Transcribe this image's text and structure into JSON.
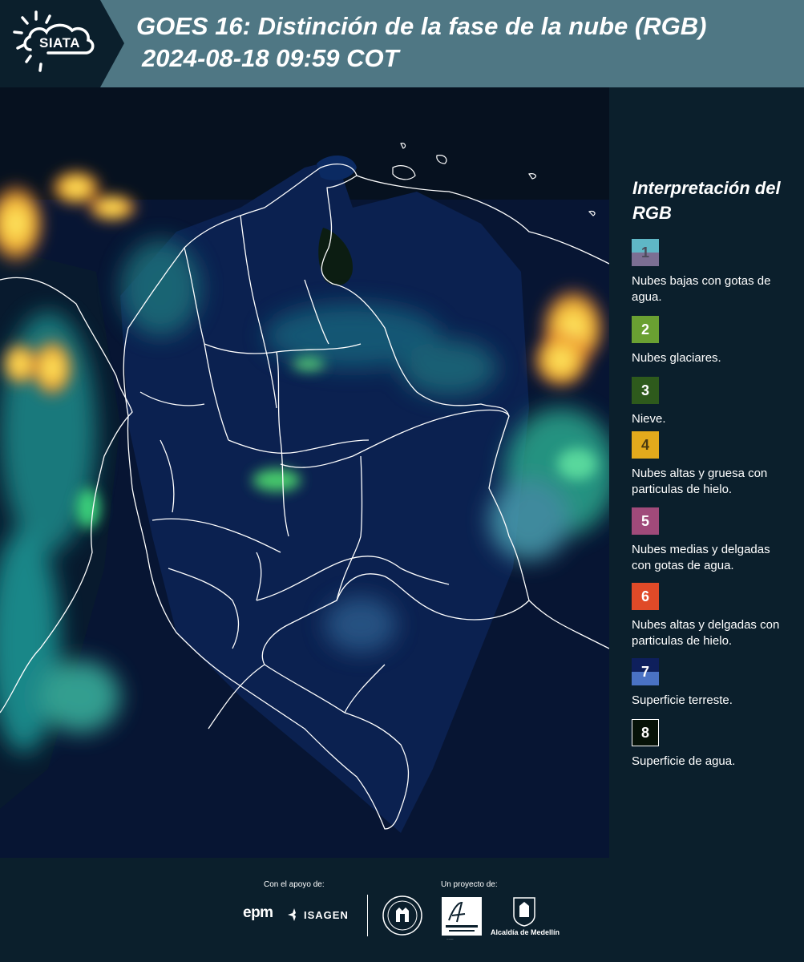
{
  "header": {
    "logo_text": "SIATA",
    "title_line1": "GOES 16: Distinción de la fase de la nube (RGB)",
    "title_line2": "2024-08-18 09:59 COT"
  },
  "legend": {
    "title": "Interpretación del RGB",
    "items": [
      {
        "num": "1",
        "label": "Nubes bajas con gotas de agua.",
        "color_top": "#5fb7c6",
        "color_bottom": "#7c6f93",
        "num_color": "#4b4b5a"
      },
      {
        "num": "2",
        "label": "Nubes glaciares.",
        "color_top": "#6aa032",
        "color_bottom": "#6aa032",
        "num_color": "#ffffff"
      },
      {
        "num": "3",
        "label": "Nieve.",
        "color_top": "#2e5a1c",
        "color_bottom": "#2e5a1c",
        "num_color": "#ffffff"
      },
      {
        "num": "4",
        "label": "Nubes altas y gruesa con particulas de hielo.",
        "color_top": "#e3aa1c",
        "color_bottom": "#e3aa1c",
        "num_color": "#4a3a10"
      },
      {
        "num": "5",
        "label": "Nubes medias y delgadas con gotas de agua.",
        "color_top": "#a04a7a",
        "color_bottom": "#a04a7a",
        "num_color": "#ffffff"
      },
      {
        "num": "6",
        "label": "Nubes altas y delgadas con particulas de hielo.",
        "color_top": "#e04a28",
        "color_bottom": "#e04a28",
        "num_color": "#ffffff"
      },
      {
        "num": "7",
        "label": "Superficie terreste.",
        "color_top": "#0e1f5c",
        "color_bottom": "#4a72c4",
        "num_color": "#ffffff"
      },
      {
        "num": "8",
        "label": "Superficie de agua.",
        "color_top": "#061208",
        "color_bottom": "#061208",
        "num_color": "#ffffff"
      }
    ]
  },
  "footer": {
    "support_text": "Con el apoyo de:",
    "project_text": "Un proyecto de:",
    "epm_logo": "epm",
    "isagen_logo": "ISAGEN",
    "area_logo": "Área Metropolitana",
    "alcaldia_text": "Alcaldía de Medellín"
  },
  "colors": {
    "header_bg": "#4f7784",
    "logo_bg": "#0b1f2c",
    "panel_bg": "#0b1f2c",
    "map_bg": "#071533"
  }
}
